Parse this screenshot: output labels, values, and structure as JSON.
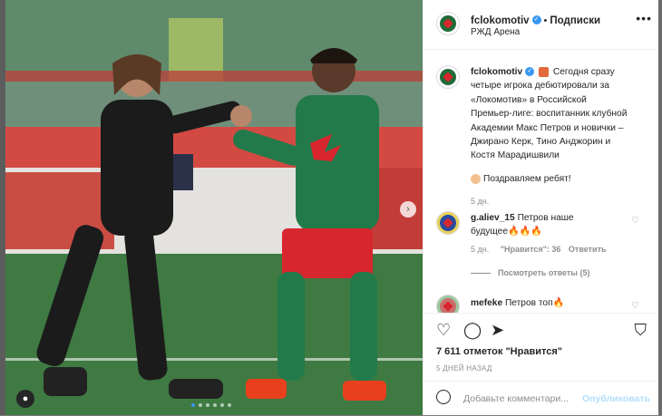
{
  "post": {
    "username": "fclokomotiv",
    "follow_label": "Подписки",
    "location": "РЖД Арена",
    "more_label": "•••",
    "caption_username": "fclokomotiv",
    "caption_lines": [
      "Сегодня сразу",
      "четыре игрока дебютировали за",
      "«Локомотив» в Российской",
      "Премьер-лиге: воспитанник клубной",
      "Академии Макс Петров и новички –",
      "Джирано Керк, Тино Анджорин и",
      "Костя Марадишвили"
    ],
    "congrats": "Поздравляем ребят!",
    "caption_age": "5 дн.",
    "likes_text": "7 611 отметок \"Нравится\"",
    "date": "5 ДНЕЙ НАЗАД",
    "comment_placeholder": "Добавьте комментари...",
    "publish_label": "Опубликовать"
  },
  "comments": [
    {
      "username": "g.aliev_15",
      "text": "Петров наше",
      "text2": "будущее🔥🔥🔥",
      "age": "5 дн.",
      "likes": "\"Нравится\": 36",
      "reply": "Ответить",
      "view_replies": "Посмотреть ответы (5)"
    },
    {
      "username": "mefeke",
      "text": "Петров топ🔥"
    }
  ],
  "icons": [
    "verified-icon",
    "more-icon",
    "heart-icon",
    "comment-icon",
    "share-icon",
    "bookmark-icon",
    "emoji-icon",
    "user-tag-icon",
    "carousel-next-icon"
  ],
  "colors": {
    "accent": "#3897f0",
    "club_green": "#1f6b3a",
    "club_red": "#d8262e"
  },
  "carousel": {
    "dots": 6,
    "active": 0
  }
}
